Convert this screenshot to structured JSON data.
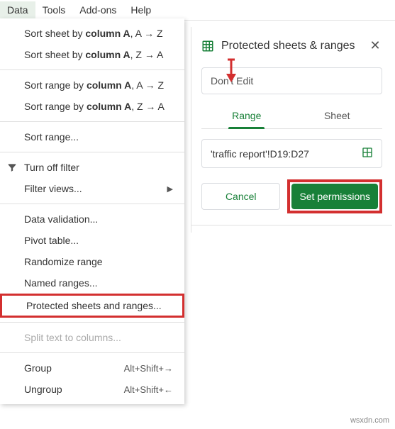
{
  "menubar": {
    "items": [
      "Data",
      "Tools",
      "Add-ons",
      "Help"
    ],
    "active_index": 0
  },
  "dropdown": {
    "sort_sheet_asc_prefix": "Sort sheet by ",
    "sort_sheet_asc_col": "column A",
    "sort_sheet_asc_suffix": ", A → Z",
    "sort_sheet_desc_prefix": "Sort sheet by ",
    "sort_sheet_desc_col": "column A",
    "sort_sheet_desc_suffix": ", Z → A",
    "sort_range_asc_prefix": "Sort range by ",
    "sort_range_asc_col": "column A",
    "sort_range_asc_suffix": ", A → Z",
    "sort_range_desc_prefix": "Sort range by ",
    "sort_range_desc_col": "column A",
    "sort_range_desc_suffix": ", Z → A",
    "sort_range": "Sort range...",
    "turn_off_filter": "Turn off filter",
    "filter_views": "Filter views...",
    "data_validation": "Data validation...",
    "pivot_table": "Pivot table...",
    "randomize_range": "Randomize range",
    "named_ranges": "Named ranges...",
    "protected_sheets": "Protected sheets and ranges...",
    "split_text": "Split text to columns...",
    "group": "Group",
    "group_shortcut": "Alt+Shift+→",
    "ungroup": "Ungroup",
    "ungroup_shortcut": "Alt+Shift+←"
  },
  "panel": {
    "title": "Protected sheets & ranges",
    "description": "Don't Edit",
    "tabs": {
      "range": "Range",
      "sheet": "Sheet"
    },
    "range_value": "'traffic report'!D19:D27",
    "cancel": "Cancel",
    "set_permissions": "Set permissions"
  },
  "watermark": "wsxdn.com"
}
